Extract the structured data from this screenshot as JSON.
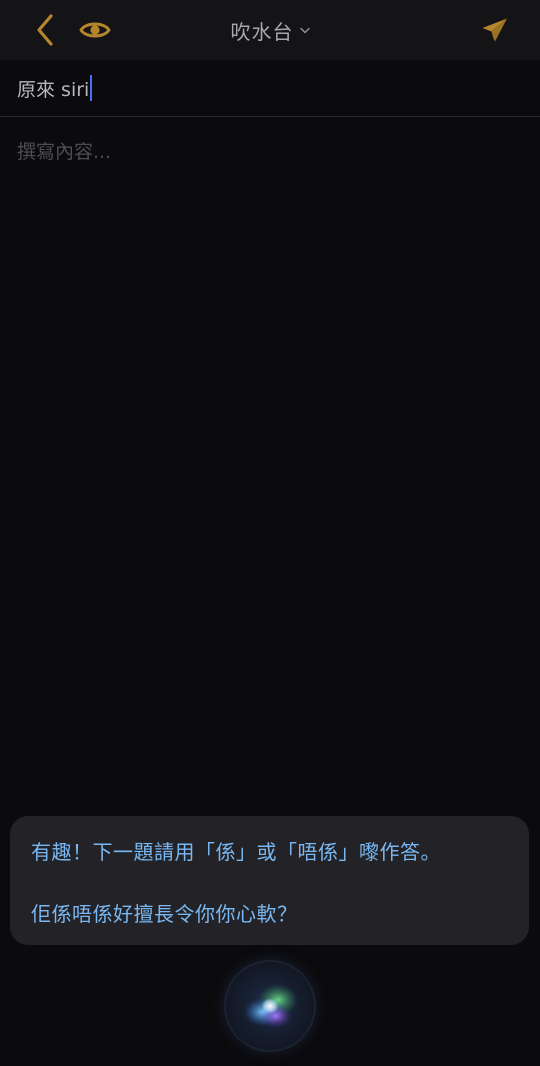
{
  "nav": {
    "back_icon": "chevron-left-icon",
    "preview_icon": "eye-icon",
    "title": "吹水台",
    "title_dropdown_icon": "chevron-down-icon",
    "send_icon": "paper-plane-icon",
    "accent_color": "#b5862c"
  },
  "compose": {
    "subject_value": "原來 siri",
    "content_placeholder": "撰寫內容..."
  },
  "siri": {
    "line1": "有趣！下一題請用「係」或「唔係」嚟作答。",
    "line2": "佢係唔係好擅長令你你心軟？",
    "text_color": "#79b8f2",
    "orb_icon": "siri-orb-icon"
  }
}
